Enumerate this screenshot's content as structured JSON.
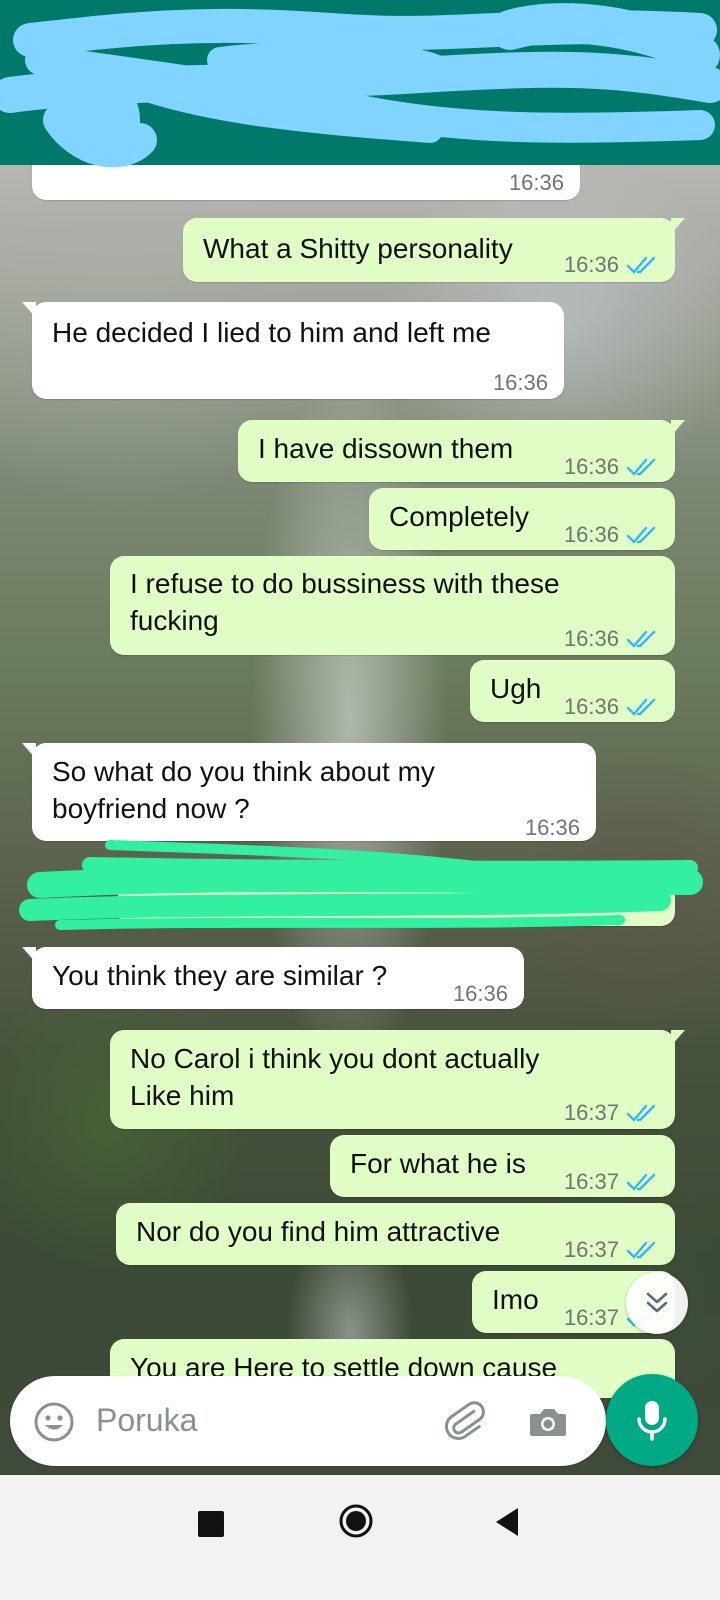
{
  "input": {
    "placeholder": "Poruka"
  },
  "colors": {
    "header": "#00796b",
    "outgoing": "#e1fec6",
    "incoming": "#ffffff",
    "accent": "#00a884",
    "tick": "#34b7f1"
  },
  "messages": [
    {
      "dir": "in",
      "text": "",
      "time": "16:36"
    },
    {
      "dir": "out",
      "text": "What a Shitty personality",
      "time": "16:36",
      "status": "read"
    },
    {
      "dir": "in",
      "text": "He decided I lied to him and left me",
      "time": "16:36"
    },
    {
      "dir": "out",
      "text": "I have dissown them",
      "time": "16:36",
      "status": "read"
    },
    {
      "dir": "out",
      "text": "Completely",
      "time": "16:36",
      "status": "read"
    },
    {
      "dir": "out",
      "line1": "I refuse to do bussiness with these",
      "line2": "fucking",
      "time": "16:36",
      "status": "read"
    },
    {
      "dir": "out",
      "text": "Ugh",
      "time": "16:36",
      "status": "read"
    },
    {
      "dir": "in",
      "line1": "So what do you think about my",
      "line2": "boyfriend now ?",
      "time": "16:36"
    },
    {
      "dir": "out",
      "text": "",
      "redacted": true
    },
    {
      "dir": "in",
      "text": "You think they are similar ?",
      "time": "16:36"
    },
    {
      "dir": "out",
      "line1": "No Carol i think you dont actually",
      "line2": "Like him",
      "time": "16:37",
      "status": "read"
    },
    {
      "dir": "out",
      "text": "For what he is",
      "time": "16:37",
      "status": "read"
    },
    {
      "dir": "out",
      "text": "Nor do you find him attractive",
      "time": "16:37",
      "status": "read"
    },
    {
      "dir": "out",
      "text": "Imo",
      "time": "16:37",
      "status": "read"
    },
    {
      "dir": "out",
      "text": "You are Here to settle down cause"
    }
  ]
}
